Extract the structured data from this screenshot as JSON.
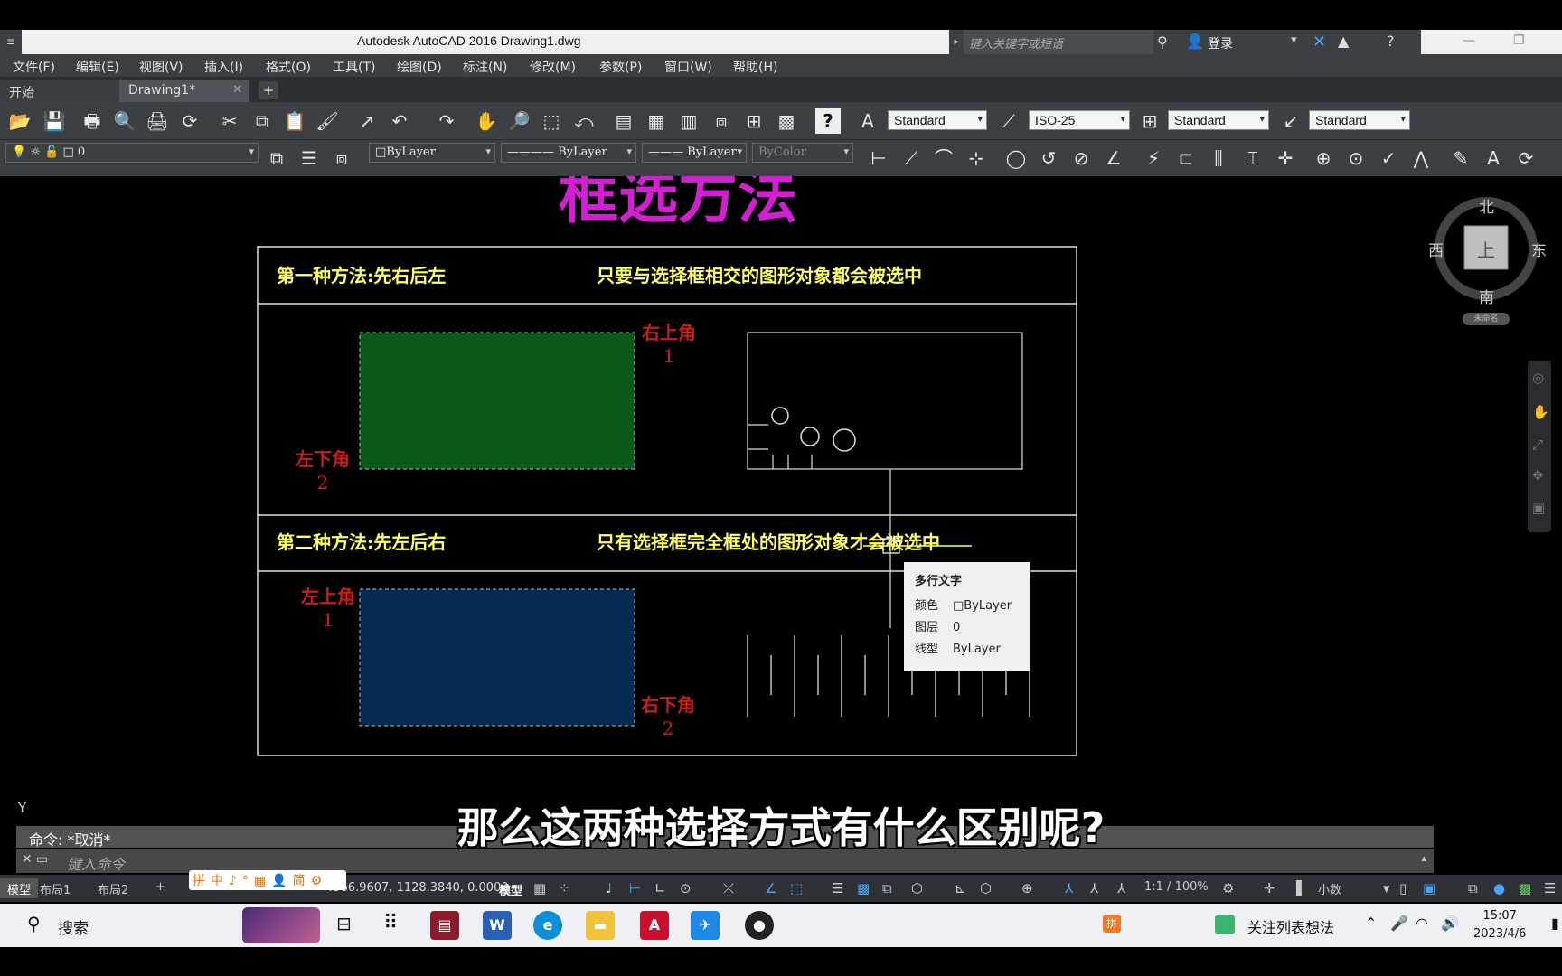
{
  "window": {
    "title": "Autodesk AutoCAD 2016    Drawing1.dwg",
    "search_placeholder": "键入关键字或短语",
    "login": "登录"
  },
  "menu": [
    "文件(F)",
    "编辑(E)",
    "视图(V)",
    "插入(I)",
    "格式(O)",
    "工具(T)",
    "绘图(D)",
    "标注(N)",
    "修改(M)",
    "参数(P)",
    "窗口(W)",
    "帮助(H)"
  ],
  "tabs": {
    "start": "开始",
    "active": "Drawing1*",
    "add": "+"
  },
  "toolbar": {
    "text_style": "Standard",
    "dim_style": "ISO-25",
    "table_style": "Standard",
    "mleader_style": "Standard",
    "layer": "0",
    "color": "ByLayer",
    "linetype": "ByLayer",
    "lineweight": "ByLayer",
    "plotstyle": "ByColor"
  },
  "drawing": {
    "title": "框选方法",
    "method1": "第一种方法:先右后左",
    "method1_desc": "只要与选择框相交的图形对象都会被选中",
    "method2": "第二种方法:先左后右",
    "method2_desc": "只有选择框完全框处的图形对象才会被选中",
    "upper_right": "右上角",
    "lower_left": "左下角",
    "upper_left": "左上角",
    "lower_right": "右下角",
    "num1": "1",
    "num2": "2",
    "colors": {
      "green_fill": "#0b5a1a",
      "blue_fill": "#062a52",
      "magenta": "#d21fd2",
      "yellow": "#ffff66",
      "red": "#c81e1e"
    }
  },
  "tooltip": {
    "title": "多行文字",
    "color_label": "颜色",
    "color_value": "ByLayer",
    "layer_label": "图层",
    "layer_value": "0",
    "linetype_label": "线型",
    "linetype_value": "ByLayer"
  },
  "compass": {
    "north": "北",
    "south": "南",
    "east": "东",
    "west": "西",
    "top": "上",
    "wcs": "未命名"
  },
  "ucs": {
    "y": "Y"
  },
  "command": {
    "history": "命令: *取消*",
    "placeholder": "键入命令"
  },
  "subtitle": "那么这两种选择方式有什么区别呢?",
  "statusbar": {
    "model_tab": "模型",
    "layout1": "布局1",
    "layout2": "布局2",
    "coords": "4566.9607, 1128.3840, 0.0000",
    "model": "模型",
    "scale": "1:1 / 100%",
    "units": "小数"
  },
  "ime": [
    "拼",
    "中",
    "♪",
    "°",
    "▦",
    "👤",
    "简",
    "⚙"
  ],
  "taskbar": {
    "search": "搜索",
    "tray_text": "关注列表想法",
    "time": "15:07",
    "date": "2023/4/6"
  }
}
